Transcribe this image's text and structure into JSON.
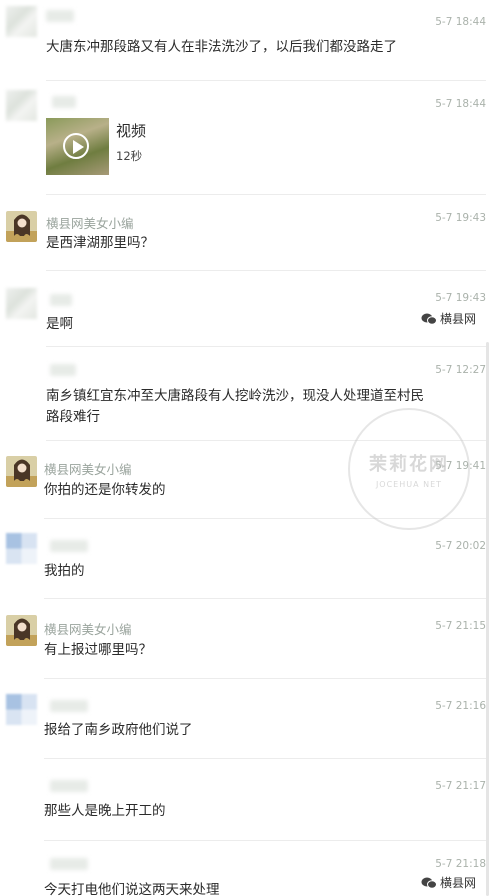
{
  "comments": [
    {
      "name": "",
      "time": "5-7 18:44",
      "text": "大唐东冲那段路又有人在非法洗沙了，以后我们都没路走了"
    },
    {
      "name": "",
      "time": "5-7 18:44",
      "video": {
        "title": "视频",
        "duration": "12秒"
      }
    },
    {
      "name": "横县网美女小编",
      "time": "5-7 19:43",
      "text": "是西津湖那里吗？"
    },
    {
      "name": "",
      "time": "5-7 19:43",
      "text": "是啊"
    },
    {
      "name": "",
      "time": "5-7 12:27",
      "text_line1": "南乡镇红宜东冲至大唐路段有人挖岭洗沙，现没人处理道至村民",
      "text_line2": "路段难行"
    },
    {
      "name": "横县网美女小编",
      "time": "5-7 19:41",
      "text": "你拍的还是你转发的"
    },
    {
      "name": "",
      "time": "5-7 20:02",
      "text": "我拍的"
    },
    {
      "name": "横县网美女小编",
      "time": "5-7 21:15",
      "text": "有上报过哪里吗？"
    },
    {
      "name": "",
      "time": "5-7 21:16",
      "text": "报给了南乡政府他们说了"
    },
    {
      "name": "",
      "time": "5-7 21:17",
      "text": "那些人是晚上开工的"
    },
    {
      "name": "",
      "time": "5-7 21:18",
      "text": "今天打电他们说这两天来处理"
    }
  ],
  "watermark": {
    "brand": "横县网",
    "stamp_title": "茉莉花网",
    "stamp_sub": "JOCEHUA NET"
  },
  "colors": {
    "name": "#9aa49d",
    "time": "#aab2ab",
    "text": "#2b2b2b",
    "divider": "#ececec"
  }
}
